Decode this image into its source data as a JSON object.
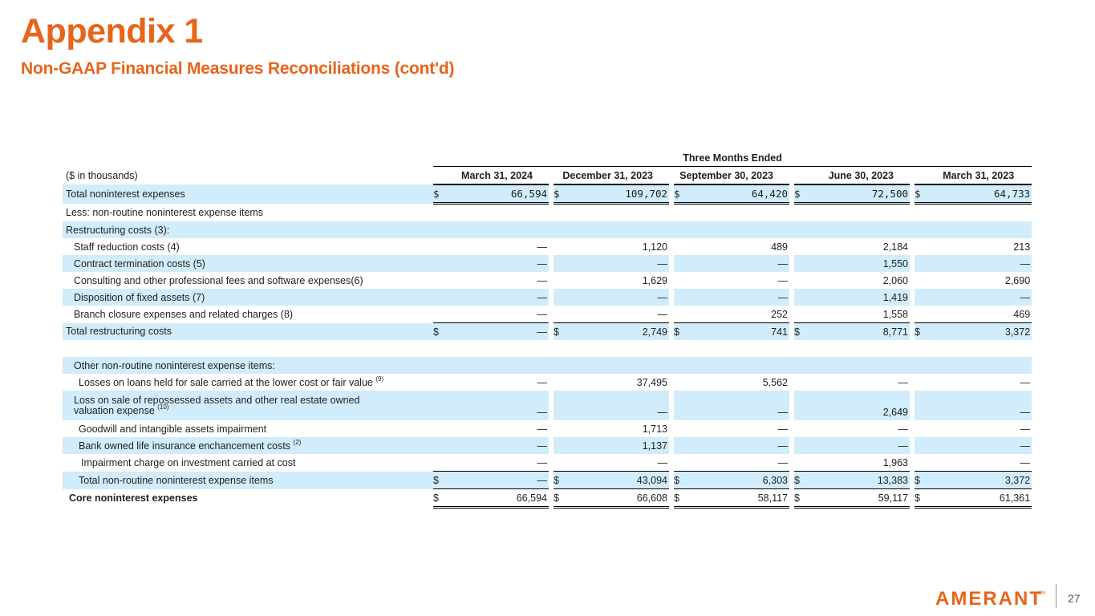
{
  "title": "Appendix 1",
  "subtitle": "Non-GAAP Financial Measures Reconciliations (cont'd)",
  "table": {
    "period_header": "Three Months Ended",
    "units_label": "($ in thousands)",
    "columns": [
      "March 31, 2024",
      "December 31, 2023",
      "September 30, 2023",
      "June 30, 2023",
      "March 31, 2023"
    ],
    "currency_symbol": "$",
    "rows": [
      {
        "label": "Total noninterest expenses",
        "values": [
          "66,594",
          "109,702",
          "64,420",
          "72,500",
          "64,733"
        ]
      },
      {
        "label": "Less: non-routine noninterest expense items"
      },
      {
        "label": "Restructuring costs (3):"
      },
      {
        "label": "Staff reduction costs (4)",
        "values": [
          "—",
          "1,120",
          "489",
          "2,184",
          "213"
        ]
      },
      {
        "label": "Contract termination costs (5)",
        "values": [
          "—",
          "—",
          "—",
          "1,550",
          "—"
        ]
      },
      {
        "label": "Consulting and other professional fees and software expenses(6)",
        "values": [
          "—",
          "1,629",
          "—",
          "2,060",
          "2,690"
        ]
      },
      {
        "label": "Disposition of fixed assets (7)",
        "values": [
          "—",
          "—",
          "—",
          "1,419",
          "—"
        ]
      },
      {
        "label": "Branch closure expenses and related charges (8)",
        "values": [
          "—",
          "—",
          "252",
          "1,558",
          "469"
        ]
      },
      {
        "label": "Total restructuring costs",
        "values": [
          "—",
          "2,749",
          "741",
          "8,771",
          "3,372"
        ]
      },
      {
        "label": "Other non-routine noninterest expense items:"
      },
      {
        "label": "Losses on loans held for sale carried at the lower cost or fair value",
        "note": "(9)",
        "values": [
          "—",
          "37,495",
          "5,562",
          "—",
          "—"
        ]
      },
      {
        "label": "Loss on sale of repossessed assets and other real estate owned valuation expense",
        "note": "(10)",
        "values": [
          "—",
          "—",
          "—",
          "2,649",
          "—"
        ]
      },
      {
        "label": "Goodwill and intangible assets impairment",
        "values": [
          "—",
          "1,713",
          "—",
          "—",
          "—"
        ]
      },
      {
        "label": "Bank owned life insurance enchancement costs",
        "note": "(2)",
        "values": [
          "—",
          "1,137",
          "—",
          "—",
          "—"
        ]
      },
      {
        "label": "Impairment charge on investment carried at cost",
        "values": [
          "—",
          "—",
          "—",
          "1,963",
          "—"
        ]
      },
      {
        "label": "Total non-routine noninterest expense items",
        "values": [
          "—",
          "43,094",
          "6,303",
          "13,383",
          "3,372"
        ]
      },
      {
        "label": "Core noninterest expenses",
        "values": [
          "66,594",
          "66,608",
          "58,117",
          "59,117",
          "61,361"
        ]
      }
    ]
  },
  "logo_text": "AMERANT",
  "logo_mark": "SM",
  "page_number": "27",
  "colors": {
    "accent": "#e8641b",
    "row_shade": "#d1ecfa"
  }
}
